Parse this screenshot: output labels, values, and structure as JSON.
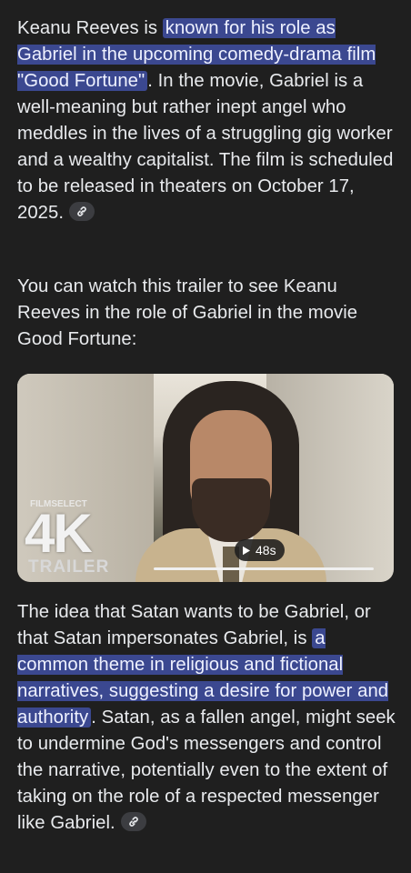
{
  "paragraph1": {
    "before": "Keanu Reeves is ",
    "highlight": "known for his role as Gabriel in the upcoming comedy-drama film \"Good Fortune\"",
    "after": ". In the movie, Gabriel is a well-meaning but rather inept angel who meddles in the lives of a struggling gig worker and a wealthy capitalist. The film is scheduled to be released in theaters on October 17, 2025."
  },
  "paragraph2": {
    "text": "You can watch this trailer to see Keanu Reeves in the role of Gabriel in the movie Good Fortune:"
  },
  "video": {
    "brand": "FILMSELECT",
    "quality": "4K",
    "label": "TRAILER",
    "duration": "48s",
    "play_icon": "play-icon"
  },
  "paragraph3": {
    "before": "The idea that Satan wants to be Gabriel, or that Satan impersonates Gabriel, is ",
    "highlight": "a common theme in religious and fictional narratives, suggesting a desire for power and authority",
    "after": ". Satan, as a fallen angel, might seek to undermine God's messengers and control the narrative, potentially even to the extent of taking on the role of a respected messenger like Gabriel."
  },
  "colors": {
    "background": "#1f1f1f",
    "text": "#e8eaed",
    "highlight": "#3b4890",
    "chip": "#3c3d41"
  },
  "icons": [
    "link-icon",
    "play-icon"
  ]
}
